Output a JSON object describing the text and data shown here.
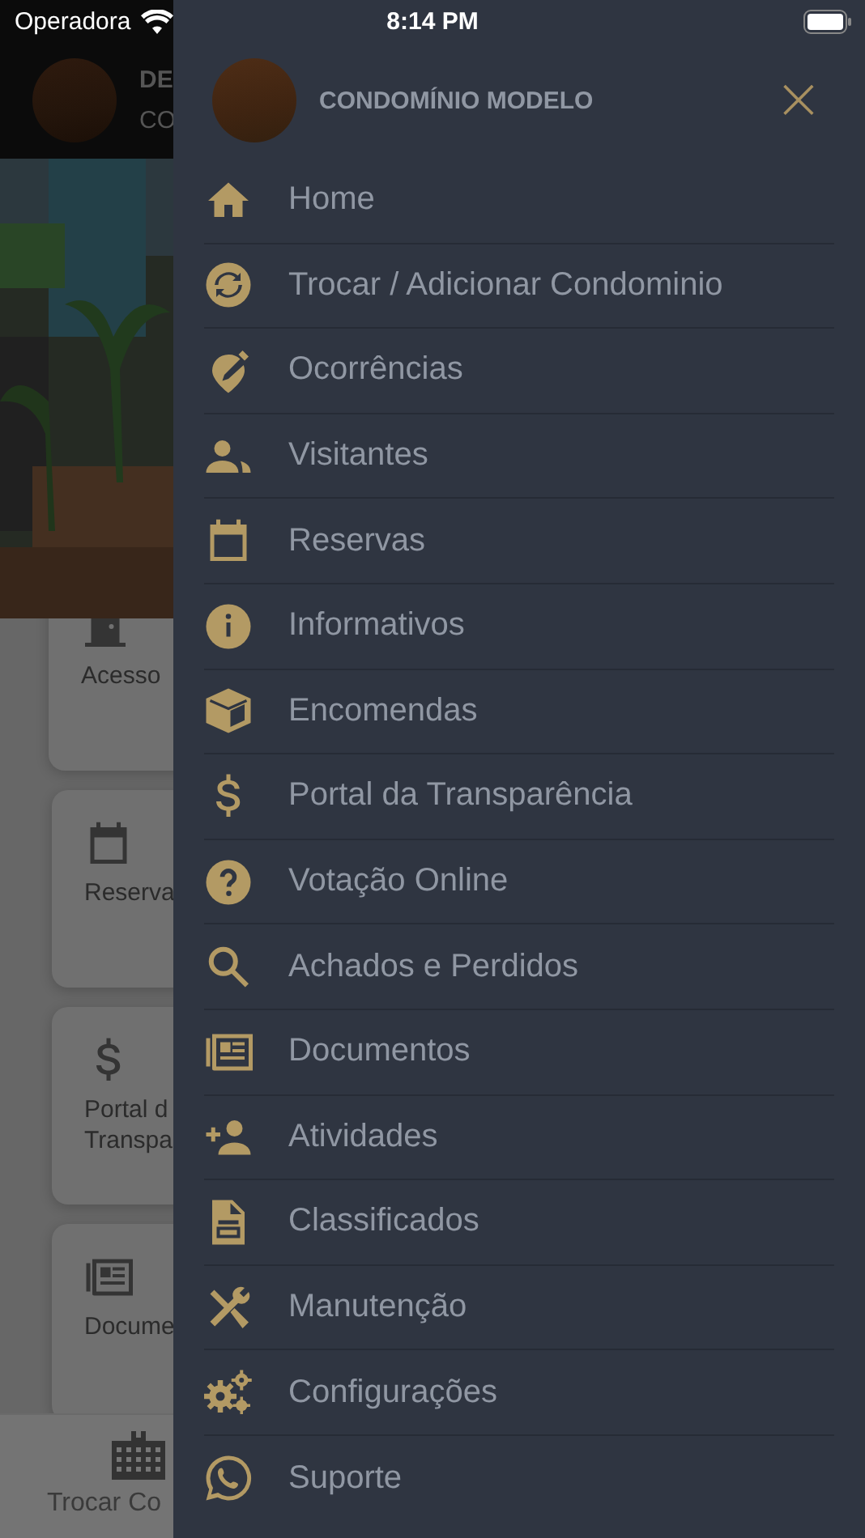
{
  "status_bar": {
    "carrier": "Operadora",
    "time": "8:14 PM"
  },
  "background_app": {
    "header": {
      "line_1": "DE",
      "line_2": "CO"
    },
    "cards": [
      {
        "lines": [
          "Acesso"
        ]
      },
      {
        "lines": [
          "Reserva"
        ]
      },
      {
        "lines": [
          "Portal d",
          "Transpa"
        ]
      },
      {
        "lines": [
          "Docume"
        ]
      }
    ],
    "bottom_tab": {
      "label": "Trocar Co"
    }
  },
  "drawer": {
    "title": "CONDOMÍNIO MODELO",
    "close": "×",
    "items": [
      {
        "label": "Home"
      },
      {
        "label": "Trocar / Adicionar Condominio"
      },
      {
        "label": "Ocorrências"
      },
      {
        "label": "Visitantes"
      },
      {
        "label": "Reservas"
      },
      {
        "label": "Informativos"
      },
      {
        "label": "Encomendas"
      },
      {
        "label": "Portal da Transparência"
      },
      {
        "label": "Votação Online"
      },
      {
        "label": "Achados e Perdidos"
      },
      {
        "label": "Documentos"
      },
      {
        "label": "Atividades"
      },
      {
        "label": "Classificados"
      },
      {
        "label": "Manutenção"
      },
      {
        "label": "Configurações"
      },
      {
        "label": "Suporte"
      }
    ]
  }
}
